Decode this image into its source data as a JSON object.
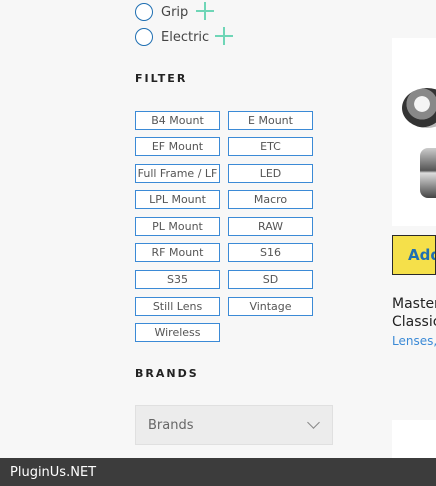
{
  "categories": [
    {
      "label": "Grip"
    },
    {
      "label": "Electric"
    }
  ],
  "filter": {
    "title": "FILTER",
    "tags": [
      "B4 Mount",
      "E Mount",
      "EF Mount",
      "ETC",
      "Full Frame / LF",
      "LED",
      "LPL Mount",
      "Macro",
      "PL Mount",
      "RAW",
      "RF Mount",
      "S16",
      "S35",
      "SD",
      "Still Lens",
      "Vintage",
      "Wireless"
    ]
  },
  "brands": {
    "title": "BRANDS",
    "select_value": "Brands"
  },
  "product": {
    "add_label": "Add",
    "title_line1": "Master",
    "title_line2": "Classic",
    "category": "Lenses,"
  },
  "footer": {
    "text": "PluginUs.NET"
  }
}
